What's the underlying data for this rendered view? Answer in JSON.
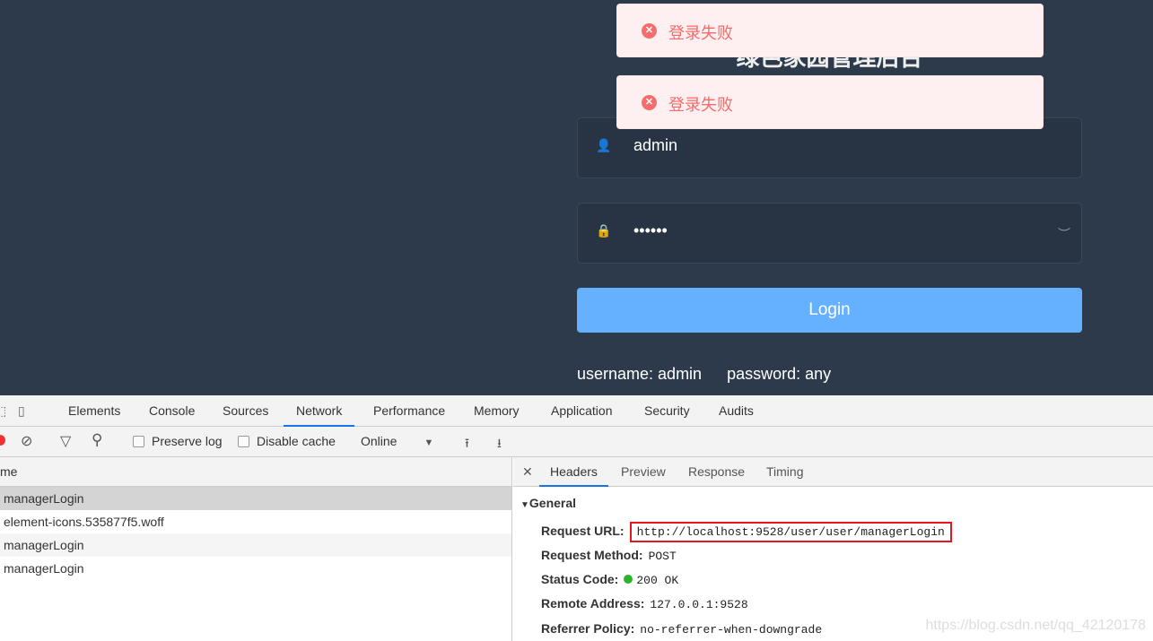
{
  "app": {
    "title": "绿色家园管理后台",
    "username": "admin",
    "password_mask": "••••••",
    "login_label": "Login",
    "tip_username": "username: admin",
    "tip_password": "password: any",
    "toasts": [
      {
        "message": "登录失败"
      },
      {
        "message": "登录失败"
      }
    ],
    "error_color": "#f56c6c",
    "button_color": "#66b1ff"
  },
  "devtools": {
    "tabs": [
      "Elements",
      "Console",
      "Sources",
      "Network",
      "Performance",
      "Memory",
      "Application",
      "Security",
      "Audits"
    ],
    "active_tab": "Network",
    "toolbar": {
      "preserve_log": "Preserve log",
      "disable_cache": "Disable cache",
      "throttle": "Online"
    },
    "list": {
      "header": "me",
      "rows": [
        "managerLogin",
        "element-icons.535877f5.woff",
        "managerLogin",
        "managerLogin"
      ]
    },
    "detail": {
      "tabs": [
        "Headers",
        "Preview",
        "Response",
        "Timing"
      ],
      "section": "General",
      "fields": [
        {
          "label": "Request URL:",
          "value": "http://localhost:9528/user/user/managerLogin"
        },
        {
          "label": "Request Method:",
          "value": "POST"
        },
        {
          "label": "Status Code:",
          "value": "200 OK"
        },
        {
          "label": "Remote Address:",
          "value": "127.0.0.1:9528"
        },
        {
          "label": "Referrer Policy:",
          "value": "no-referrer-when-downgrade"
        }
      ]
    },
    "watermark": "https://blog.csdn.net/qq_42120178"
  }
}
